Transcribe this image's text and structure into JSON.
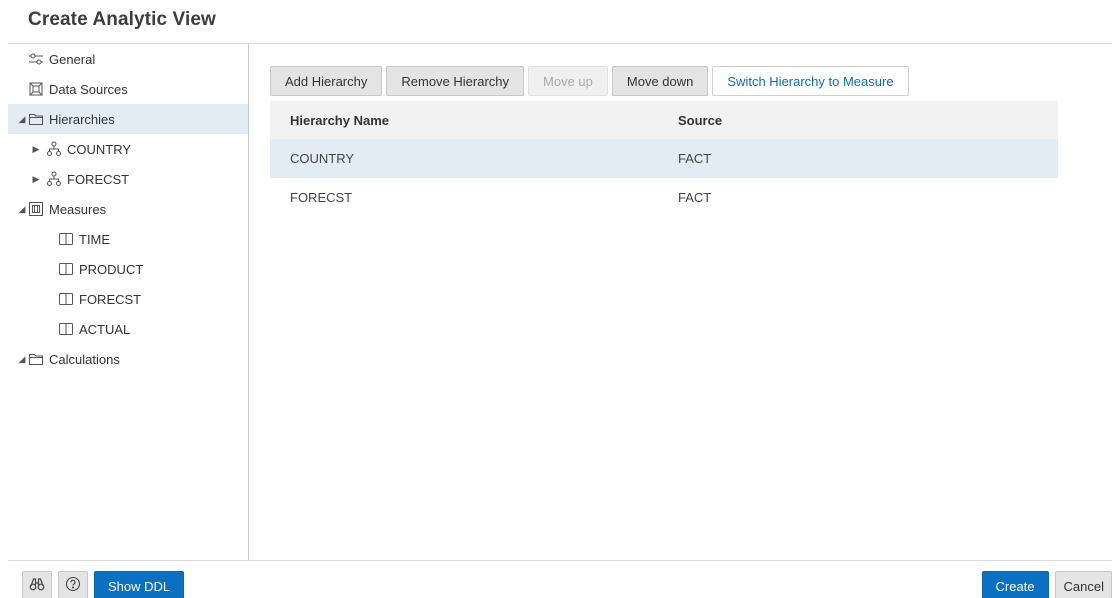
{
  "dialog": {
    "title": "Create Analytic View"
  },
  "sidebar": {
    "items": [
      {
        "label": "General",
        "icon": "sliders-icon"
      },
      {
        "label": "Data Sources",
        "icon": "data-source-icon"
      },
      {
        "label": "Hierarchies",
        "icon": "folder-icon",
        "expanded": true,
        "selected": true
      },
      {
        "label": "COUNTRY",
        "icon": "hierarchy-icon",
        "expanded": false
      },
      {
        "label": "FORECST",
        "icon": "hierarchy-icon",
        "expanded": false
      },
      {
        "label": "Measures",
        "icon": "measures-icon",
        "expanded": true
      },
      {
        "label": "TIME",
        "icon": "column-icon"
      },
      {
        "label": "PRODUCT",
        "icon": "column-icon"
      },
      {
        "label": "FORECST",
        "icon": "column-icon"
      },
      {
        "label": "ACTUAL",
        "icon": "column-icon"
      },
      {
        "label": "Calculations",
        "icon": "folder-icon",
        "expanded": true
      }
    ]
  },
  "toolbar": {
    "add_hierarchy": "Add Hierarchy",
    "remove_hierarchy": "Remove Hierarchy",
    "move_up": "Move up",
    "move_down": "Move down",
    "switch_to_measure": "Switch Hierarchy to Measure"
  },
  "grid": {
    "headers": {
      "name": "Hierarchy Name",
      "source": "Source"
    },
    "rows": [
      {
        "name": "COUNTRY",
        "source": "FACT",
        "selected": true
      },
      {
        "name": "FORECST",
        "source": "FACT",
        "selected": false
      }
    ]
  },
  "footer": {
    "show_ddl": "Show DDL",
    "create": "Create",
    "cancel": "Cancel"
  },
  "colors": {
    "accent": "#0a70c2",
    "selection": "#e1ecf4",
    "link": "#0a6fb2"
  }
}
